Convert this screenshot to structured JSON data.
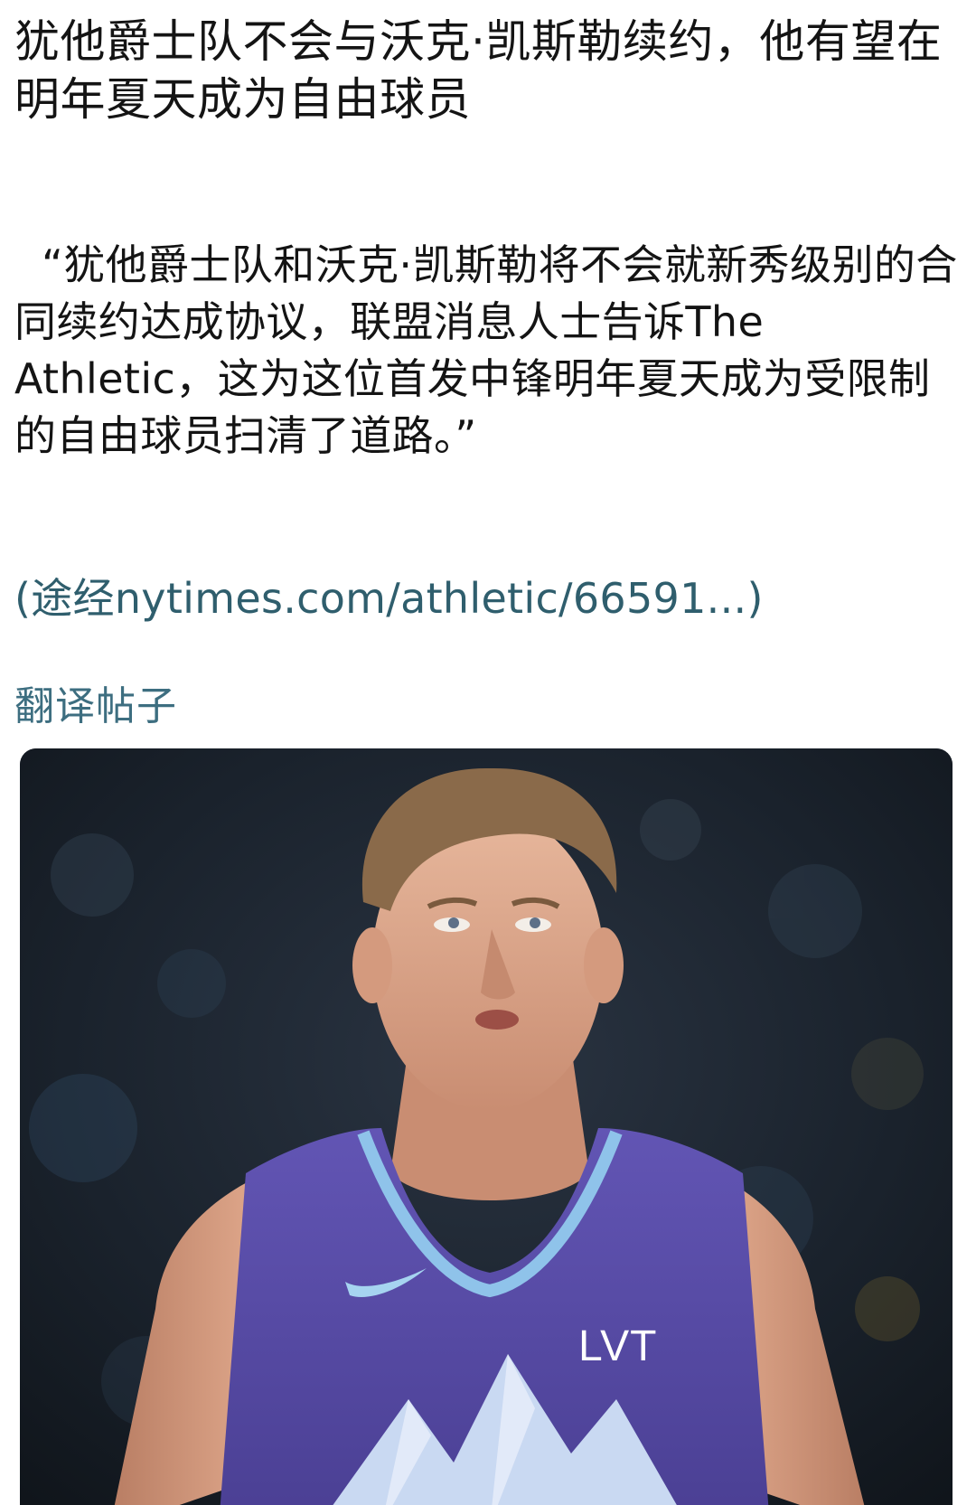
{
  "post": {
    "headline": "犹他爵士队不会与沃克·凯斯勒续约，他有望在明年夏天成为自由球员",
    "quote": "“犹他爵士队和沃克·凯斯勒将不会就新秀级别的合同续约达成协议，联盟消息人士告诉The Athletic，这为这位首发中锋明年夏天成为受限制的自由球员扫清了道路。”",
    "source_link": "(途经nytimes.com/athletic/66591...)",
    "translate_label": "翻译帖子"
  },
  "photo": {
    "jersey_text": "LVT"
  },
  "colors": {
    "link": "#2f5e6d",
    "translate": "#3d6e80",
    "jersey": "#5a4ea8"
  }
}
